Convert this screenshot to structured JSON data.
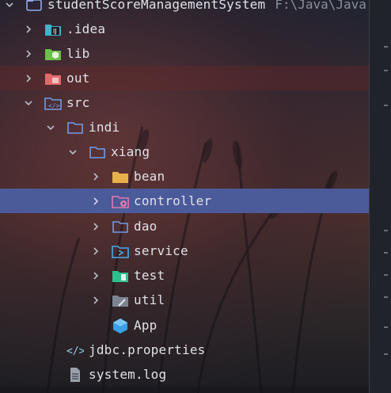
{
  "tree": {
    "root": {
      "label": "studentScoreManagementSystem",
      "path": "F:\\Java\\Java"
    },
    "items": [
      {
        "label": ".idea",
        "icon": "idea-folder-icon"
      },
      {
        "label": "lib",
        "icon": "library-folder-icon"
      },
      {
        "label": "out",
        "icon": "output-folder-icon"
      },
      {
        "label": "src",
        "icon": "source-folder-icon"
      },
      {
        "label": "indi",
        "icon": "package-icon"
      },
      {
        "label": "xiang",
        "icon": "package-icon"
      },
      {
        "label": "bean",
        "icon": "folder-icon"
      },
      {
        "label": "controller",
        "icon": "gear-folder-icon"
      },
      {
        "label": "dao",
        "icon": "package-icon"
      },
      {
        "label": "service",
        "icon": "service-folder-icon"
      },
      {
        "label": "test",
        "icon": "test-folder-icon"
      },
      {
        "label": "util",
        "icon": "util-folder-icon"
      },
      {
        "label": "App",
        "icon": "cube-icon"
      },
      {
        "label": "jdbc.properties",
        "icon": "properties-file-icon"
      },
      {
        "label": "system.log",
        "icon": "text-file-icon"
      }
    ]
  },
  "colors": {
    "selection": "#4b5a99",
    "accent_blue": "#6f9be8",
    "bean_yellow": "#e8b04a",
    "out_red": "#d9534f"
  }
}
